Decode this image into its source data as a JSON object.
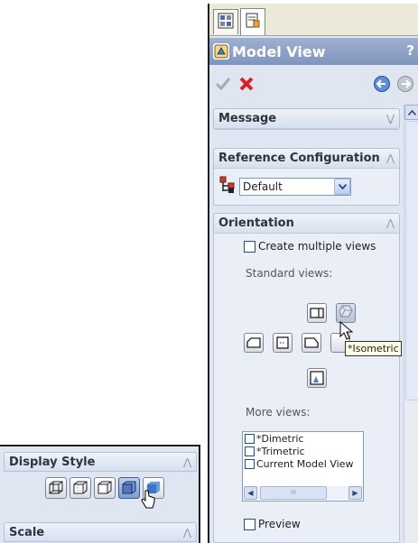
{
  "property_manager": {
    "title": "Model View",
    "help_label": "?",
    "sections": {
      "message": {
        "label": "Message"
      },
      "reference_configuration": {
        "label": "Reference Configuration",
        "selected_value": "Default"
      },
      "orientation": {
        "label": "Orientation",
        "create_multiple_views_label": "Create multiple views",
        "standard_views_label": "Standard views:",
        "tooltip": "*Isometric",
        "more_views_label": "More views:",
        "more_views": [
          "*Dimetric",
          "*Trimetric",
          "Current Model View"
        ],
        "scroll_thumb_text": "III",
        "preview_label": "Preview"
      }
    }
  },
  "inset_panel": {
    "display_style_label": "Display Style",
    "scale_label": "Scale"
  },
  "colors": {
    "panel_bg": "#dfe6f1",
    "title_bar": "#8598c0",
    "ok_check": "#9aa1ab",
    "cancel_x": "#d2232a",
    "active_button": "#7d9bcc"
  },
  "icons": [
    "feature-manager-tab-icon",
    "property-manager-tab-icon",
    "model-view-icon",
    "ok-check-icon",
    "cancel-x-icon",
    "back-arrow-icon",
    "forward-arrow-icon",
    "configuration-icon",
    "isometric-view-icon"
  ]
}
